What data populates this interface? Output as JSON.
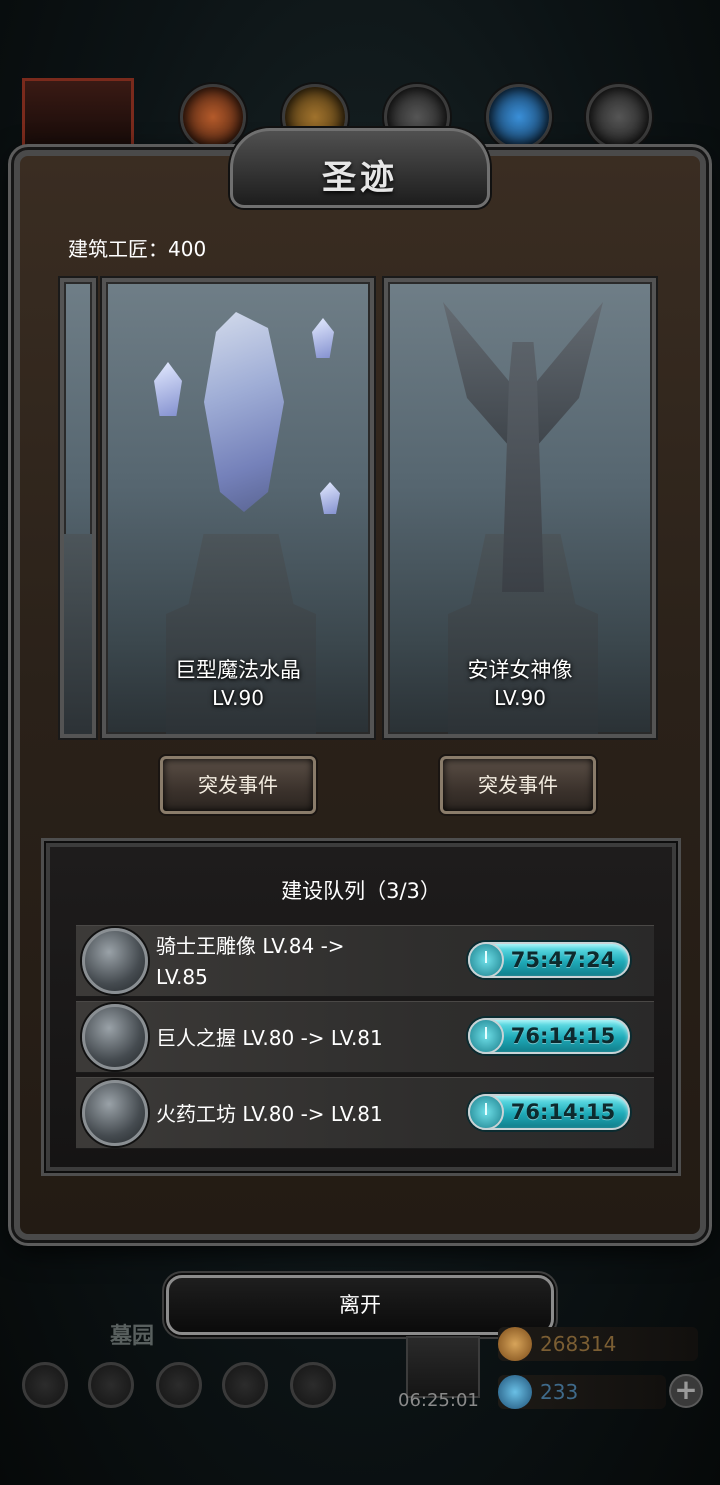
{
  "window_title": "圣迹",
  "builder": {
    "label": "建筑工匠：400"
  },
  "cards": [
    {
      "name": "巨型魔法水晶",
      "level": "LV.90"
    },
    {
      "name": "安详女神像",
      "level": "LV.90"
    }
  ],
  "event_button_label": "突发事件",
  "queue": {
    "title": "建设队列（3/3）",
    "items": [
      {
        "name_line1": "骑士王雕像 LV.84 ->",
        "name_line2": "LV.85",
        "timer": "75:47:24"
      },
      {
        "name_line1": "巨人之握 LV.80 -> LV.81",
        "name_line2": "",
        "timer": "76:14:15"
      },
      {
        "name_line1": "火药工坊 LV.80 -> LV.81",
        "name_line2": "",
        "timer": "76:14:15"
      }
    ]
  },
  "leave_button_label": "离开",
  "hud": {
    "location": "墓园",
    "gift_timer": "06:25:01",
    "gold": "268314",
    "gems": "233",
    "plus_label": "+"
  },
  "colors": {
    "timer": "#1faab8",
    "panel": "#2a2119",
    "frame": "#4a4a4a"
  }
}
